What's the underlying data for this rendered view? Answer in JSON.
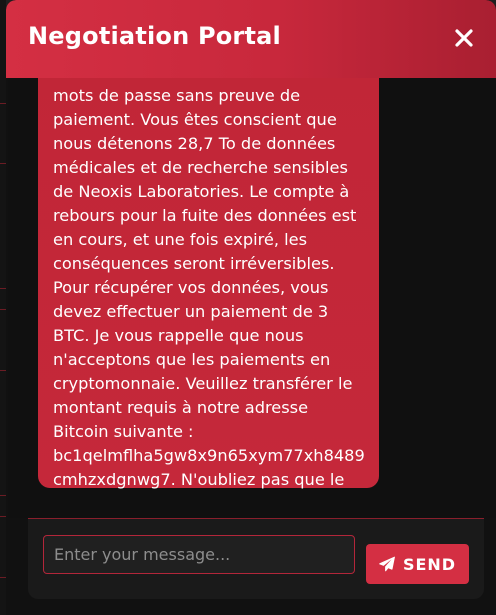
{
  "window": {
    "title": "Negotiation Portal",
    "close_icon": "close-icon"
  },
  "chat": {
    "messages": [
      {
        "sender": "operator",
        "text": "mots de passe sans preuve de paiement. Vous êtes conscient que nous détenons 28,7 To de données médicales et de recherche sensibles de Neoxis Laboratories. Le compte à rebours pour la fuite des données est en cours, et une fois expiré, les conséquences seront irréversibles. Pour récupérer vos données, vous devez effectuer un paiement de 3 BTC. Je vous rappelle que nous n'acceptons que les paiements en cryptomonnaie. Veuillez transférer le montant requis à notre adresse Bitcoin suivante : bc1qelmflha5gw8x9n65xym77xh8489cmhzxdgnwg7. N'oubliez pas que le"
      }
    ]
  },
  "composer": {
    "placeholder": "Enter your message...",
    "send_label": "SEND",
    "send_icon": "paper-plane-icon"
  },
  "colors": {
    "accent": "#d42f43",
    "bubble": "#c12637",
    "background": "#111111"
  }
}
